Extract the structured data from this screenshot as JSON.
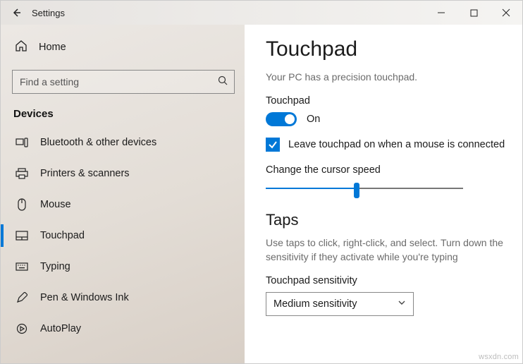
{
  "titlebar": {
    "title": "Settings"
  },
  "sidebar": {
    "home": "Home",
    "search_placeholder": "Find a setting",
    "section": "Devices",
    "items": [
      {
        "label": "Bluetooth & other devices"
      },
      {
        "label": "Printers & scanners"
      },
      {
        "label": "Mouse"
      },
      {
        "label": "Touchpad"
      },
      {
        "label": "Typing"
      },
      {
        "label": "Pen & Windows Ink"
      },
      {
        "label": "AutoPlay"
      }
    ]
  },
  "content": {
    "title": "Touchpad",
    "precision_text": "Your PC has a precision touchpad.",
    "touchpad_label": "Touchpad",
    "toggle_state": "On",
    "leave_on_label": "Leave touchpad on when a mouse is connected",
    "cursor_speed_label": "Change the cursor speed",
    "taps_heading": "Taps",
    "taps_desc": "Use taps to click, right-click, and select. Turn down the sensitivity if they activate while you're typing",
    "sensitivity_label": "Touchpad sensitivity",
    "sensitivity_value": "Medium sensitivity"
  },
  "watermark": "wsxdn.com"
}
